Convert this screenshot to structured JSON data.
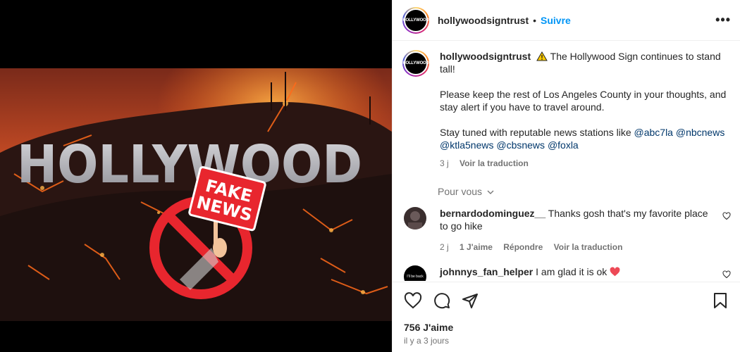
{
  "header": {
    "username": "hollywoodsigntrust",
    "dot": "•",
    "follow_label": "Suivre",
    "avatar_text": "HOLLYWOOD",
    "more_label": "•••"
  },
  "post": {
    "image_sign_text": "HOLLYWOOD",
    "image_banner_line1": "FAKE",
    "image_banner_line2": "NEWS",
    "caption": {
      "username": "hollywoodsigntrust",
      "warning_icon": "warning-icon",
      "text_line1": " The Hollywood Sign continues to stand tall!",
      "text_paragraph2": "Please keep the rest of Los Angeles County in your thoughts, and stay alert if you have to travel around.",
      "text_paragraph3_prefix": "Stay tuned with reputable news stations like ",
      "mentions": [
        "@abc7la",
        "@nbcnews",
        "@ktla5news",
        "@cbsnews",
        "@foxla"
      ],
      "age": "3 j",
      "translate": "Voir la traduction"
    },
    "for_you_label": "Pour vous",
    "comments": [
      {
        "username": "bernardodominguez__",
        "text": "Thanks gosh that's my favorite place to go hike",
        "age": "2 j",
        "likes": "1 J'aime",
        "reply": "Répondre",
        "translate": "Voir la traduction"
      },
      {
        "username": "johnnys_fan_helper",
        "text": "I am glad it is ok",
        "avatar_text": "I'll be back"
      }
    ],
    "likes_count": "756 J'aime",
    "posted_ago": "il y a 3 jours"
  },
  "colors": {
    "accent": "#0095f6",
    "mention": "#00376b",
    "muted": "#737373",
    "heart": "#ed4956",
    "fake_news_red": "#e8262e"
  }
}
